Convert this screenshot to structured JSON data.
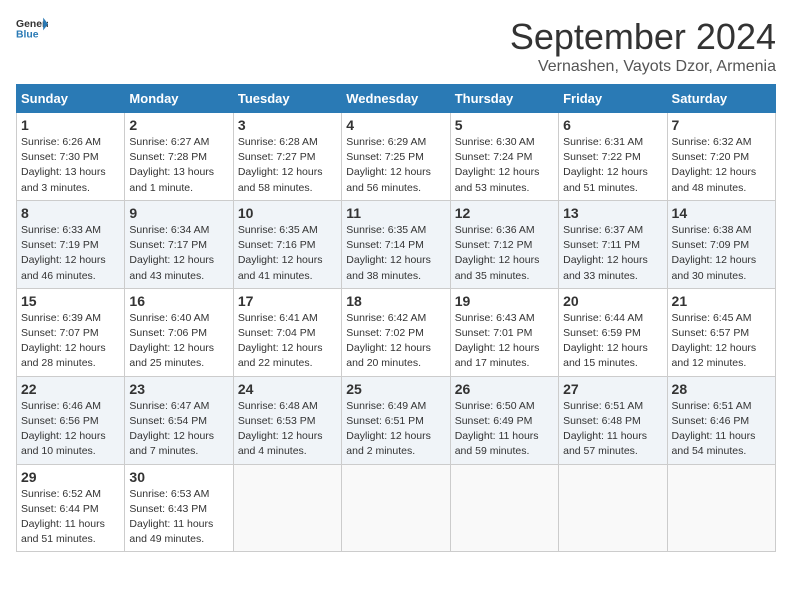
{
  "header": {
    "logo_general": "General",
    "logo_blue": "Blue",
    "month_title": "September 2024",
    "subtitle": "Vernashen, Vayots Dzor, Armenia"
  },
  "days_of_week": [
    "Sunday",
    "Monday",
    "Tuesday",
    "Wednesday",
    "Thursday",
    "Friday",
    "Saturday"
  ],
  "weeks": [
    [
      {
        "day": "1",
        "info": "Sunrise: 6:26 AM\nSunset: 7:30 PM\nDaylight: 13 hours\nand 3 minutes."
      },
      {
        "day": "2",
        "info": "Sunrise: 6:27 AM\nSunset: 7:28 PM\nDaylight: 13 hours\nand 1 minute."
      },
      {
        "day": "3",
        "info": "Sunrise: 6:28 AM\nSunset: 7:27 PM\nDaylight: 12 hours\nand 58 minutes."
      },
      {
        "day": "4",
        "info": "Sunrise: 6:29 AM\nSunset: 7:25 PM\nDaylight: 12 hours\nand 56 minutes."
      },
      {
        "day": "5",
        "info": "Sunrise: 6:30 AM\nSunset: 7:24 PM\nDaylight: 12 hours\nand 53 minutes."
      },
      {
        "day": "6",
        "info": "Sunrise: 6:31 AM\nSunset: 7:22 PM\nDaylight: 12 hours\nand 51 minutes."
      },
      {
        "day": "7",
        "info": "Sunrise: 6:32 AM\nSunset: 7:20 PM\nDaylight: 12 hours\nand 48 minutes."
      }
    ],
    [
      {
        "day": "8",
        "info": "Sunrise: 6:33 AM\nSunset: 7:19 PM\nDaylight: 12 hours\nand 46 minutes."
      },
      {
        "day": "9",
        "info": "Sunrise: 6:34 AM\nSunset: 7:17 PM\nDaylight: 12 hours\nand 43 minutes."
      },
      {
        "day": "10",
        "info": "Sunrise: 6:35 AM\nSunset: 7:16 PM\nDaylight: 12 hours\nand 41 minutes."
      },
      {
        "day": "11",
        "info": "Sunrise: 6:35 AM\nSunset: 7:14 PM\nDaylight: 12 hours\nand 38 minutes."
      },
      {
        "day": "12",
        "info": "Sunrise: 6:36 AM\nSunset: 7:12 PM\nDaylight: 12 hours\nand 35 minutes."
      },
      {
        "day": "13",
        "info": "Sunrise: 6:37 AM\nSunset: 7:11 PM\nDaylight: 12 hours\nand 33 minutes."
      },
      {
        "day": "14",
        "info": "Sunrise: 6:38 AM\nSunset: 7:09 PM\nDaylight: 12 hours\nand 30 minutes."
      }
    ],
    [
      {
        "day": "15",
        "info": "Sunrise: 6:39 AM\nSunset: 7:07 PM\nDaylight: 12 hours\nand 28 minutes."
      },
      {
        "day": "16",
        "info": "Sunrise: 6:40 AM\nSunset: 7:06 PM\nDaylight: 12 hours\nand 25 minutes."
      },
      {
        "day": "17",
        "info": "Sunrise: 6:41 AM\nSunset: 7:04 PM\nDaylight: 12 hours\nand 22 minutes."
      },
      {
        "day": "18",
        "info": "Sunrise: 6:42 AM\nSunset: 7:02 PM\nDaylight: 12 hours\nand 20 minutes."
      },
      {
        "day": "19",
        "info": "Sunrise: 6:43 AM\nSunset: 7:01 PM\nDaylight: 12 hours\nand 17 minutes."
      },
      {
        "day": "20",
        "info": "Sunrise: 6:44 AM\nSunset: 6:59 PM\nDaylight: 12 hours\nand 15 minutes."
      },
      {
        "day": "21",
        "info": "Sunrise: 6:45 AM\nSunset: 6:57 PM\nDaylight: 12 hours\nand 12 minutes."
      }
    ],
    [
      {
        "day": "22",
        "info": "Sunrise: 6:46 AM\nSunset: 6:56 PM\nDaylight: 12 hours\nand 10 minutes."
      },
      {
        "day": "23",
        "info": "Sunrise: 6:47 AM\nSunset: 6:54 PM\nDaylight: 12 hours\nand 7 minutes."
      },
      {
        "day": "24",
        "info": "Sunrise: 6:48 AM\nSunset: 6:53 PM\nDaylight: 12 hours\nand 4 minutes."
      },
      {
        "day": "25",
        "info": "Sunrise: 6:49 AM\nSunset: 6:51 PM\nDaylight: 12 hours\nand 2 minutes."
      },
      {
        "day": "26",
        "info": "Sunrise: 6:50 AM\nSunset: 6:49 PM\nDaylight: 11 hours\nand 59 minutes."
      },
      {
        "day": "27",
        "info": "Sunrise: 6:51 AM\nSunset: 6:48 PM\nDaylight: 11 hours\nand 57 minutes."
      },
      {
        "day": "28",
        "info": "Sunrise: 6:51 AM\nSunset: 6:46 PM\nDaylight: 11 hours\nand 54 minutes."
      }
    ],
    [
      {
        "day": "29",
        "info": "Sunrise: 6:52 AM\nSunset: 6:44 PM\nDaylight: 11 hours\nand 51 minutes."
      },
      {
        "day": "30",
        "info": "Sunrise: 6:53 AM\nSunset: 6:43 PM\nDaylight: 11 hours\nand 49 minutes."
      },
      {
        "day": "",
        "info": ""
      },
      {
        "day": "",
        "info": ""
      },
      {
        "day": "",
        "info": ""
      },
      {
        "day": "",
        "info": ""
      },
      {
        "day": "",
        "info": ""
      }
    ]
  ]
}
